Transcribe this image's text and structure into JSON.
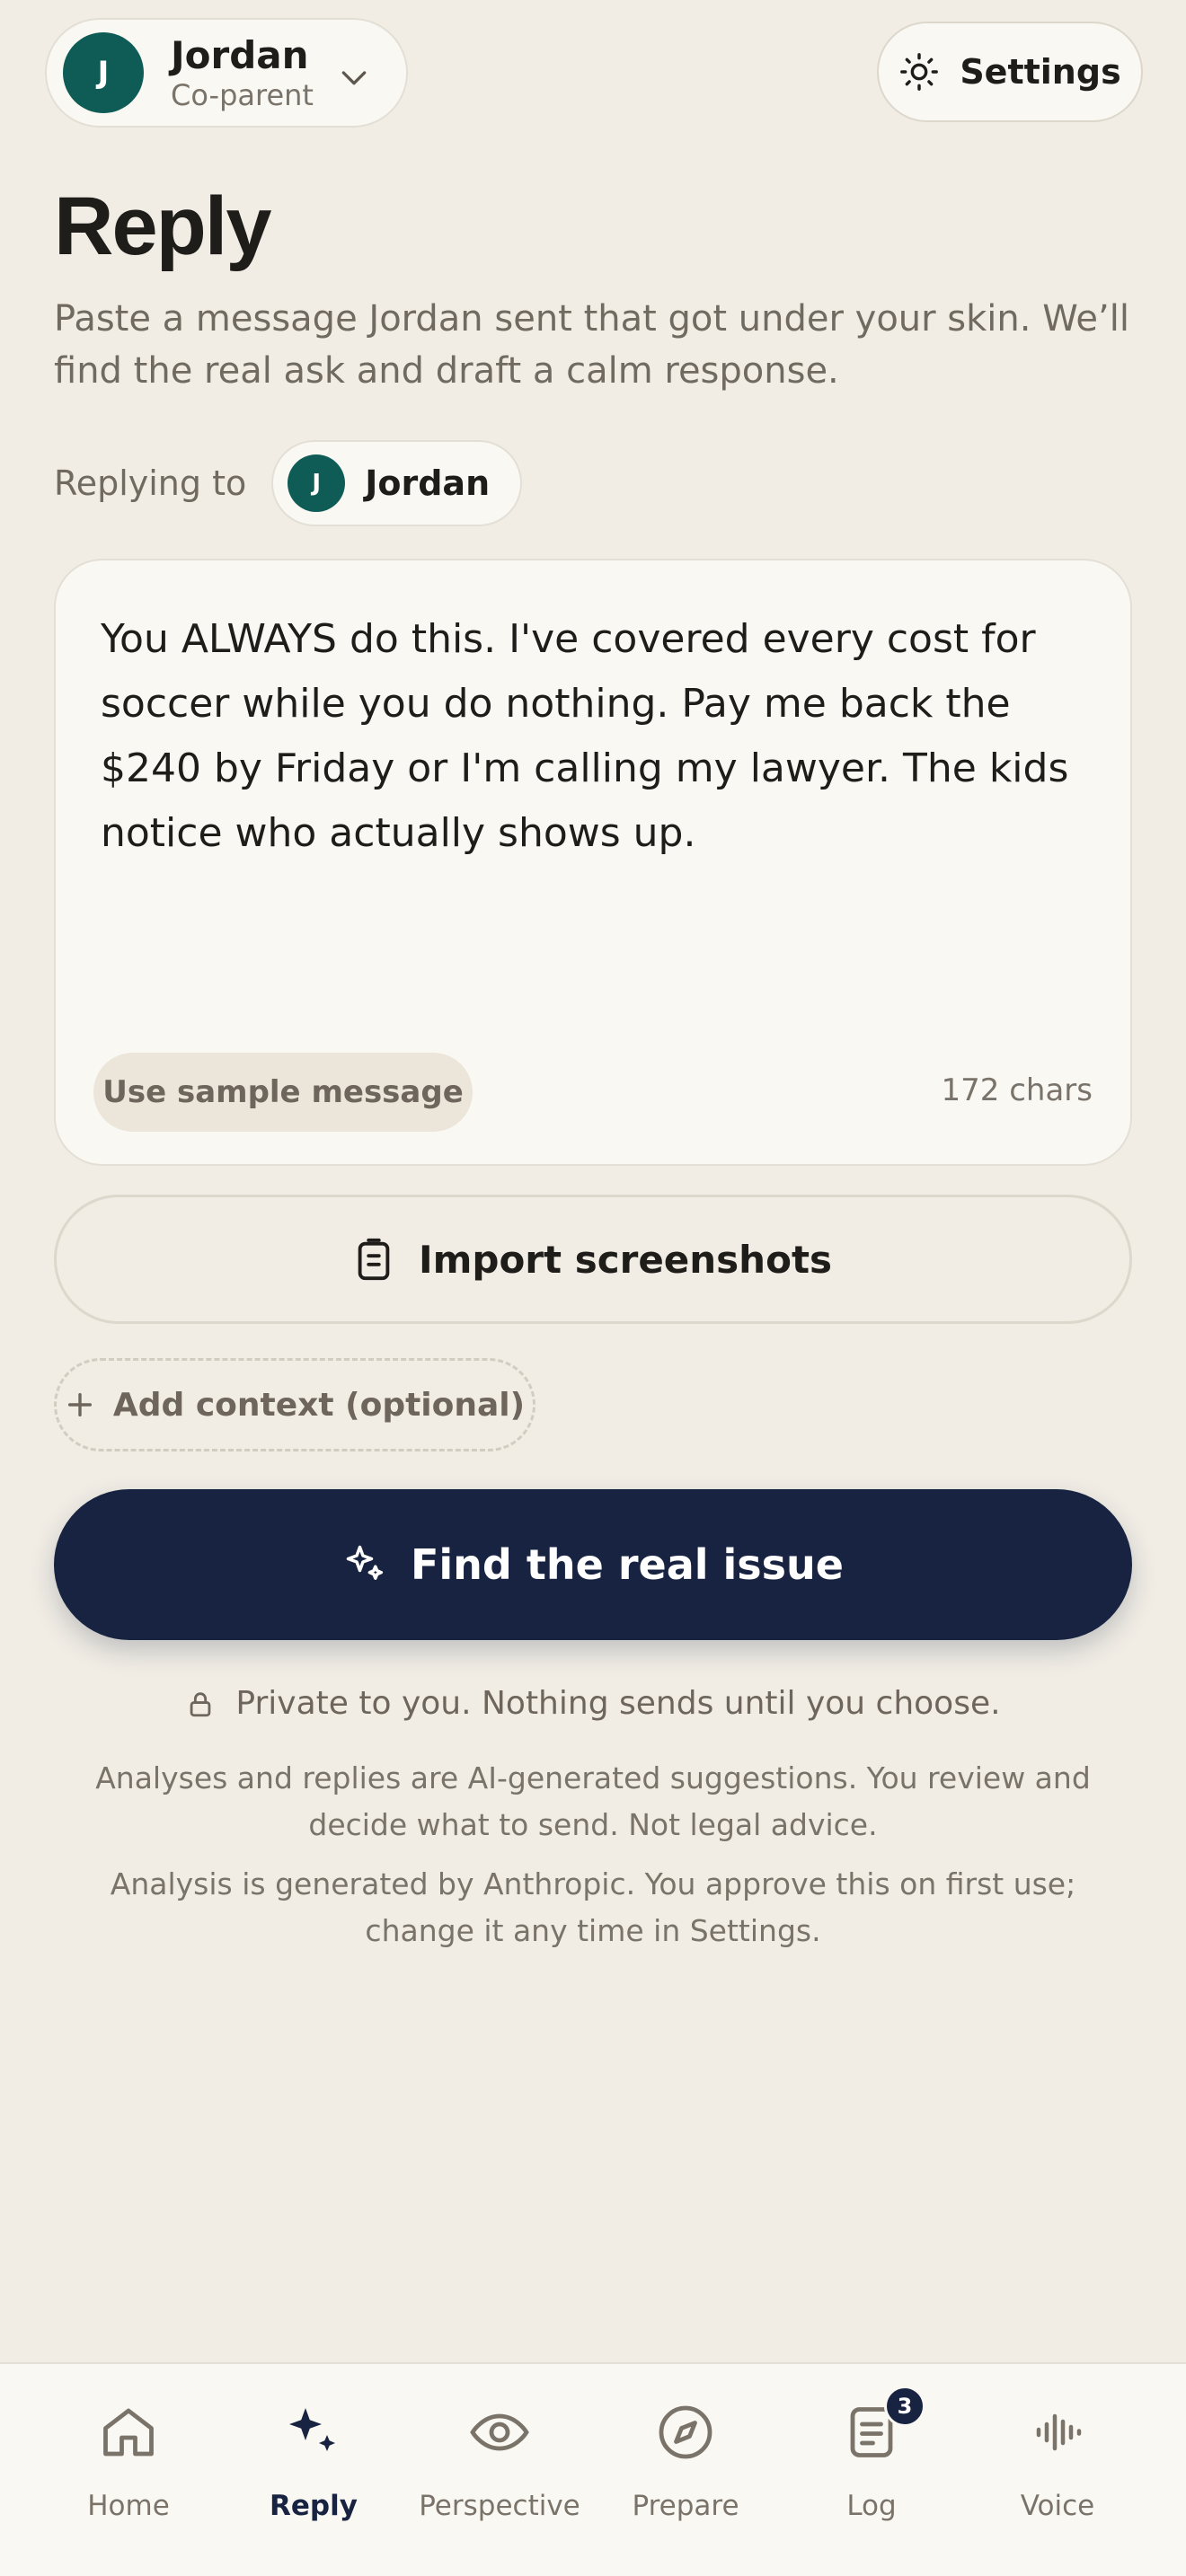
{
  "header": {
    "profile": {
      "initial": "J",
      "name": "Jordan",
      "role": "Co-parent"
    },
    "settings_label": "Settings"
  },
  "page": {
    "title": "Reply",
    "subtitle": "Paste a message Jordan sent that got under your skin. We’ll find the real ask and draft a calm response."
  },
  "recipient": {
    "label": "Replying to",
    "initial": "J",
    "name": "Jordan"
  },
  "message": {
    "text": "You ALWAYS do this. I've covered every cost for soccer while you do nothing. Pay me back the $240 by Friday or I'm calling my lawyer. The kids notice who actually shows up.",
    "sample_button": "Use sample message",
    "char_count": "172 chars"
  },
  "actions": {
    "import_label": "Import screenshots",
    "context_label": "Add context (optional)",
    "find_label": "Find the real issue"
  },
  "notes": {
    "private": "Private to you. Nothing sends until you choose.",
    "disclaimer_ai": "Analyses and replies are AI-generated suggestions. You review and decide what to send. Not legal advice.",
    "disclaimer_anthropic": "Analysis is generated by Anthropic. You approve this on first use; change it any time in Settings."
  },
  "nav": {
    "items": [
      {
        "label": "Home",
        "icon": "home-icon",
        "active": false
      },
      {
        "label": "Reply",
        "icon": "sparkle-icon",
        "active": true
      },
      {
        "label": "Perspective",
        "icon": "eye-icon",
        "active": false
      },
      {
        "label": "Prepare",
        "icon": "compass-icon",
        "active": false
      },
      {
        "label": "Log",
        "icon": "document-icon",
        "active": false,
        "badge": "3"
      },
      {
        "label": "Voice",
        "icon": "waveform-icon",
        "active": false
      }
    ]
  },
  "colors": {
    "background": "#f1ede5",
    "card": "#faf8f3",
    "primary": "#172340",
    "avatar": "#0f5c56",
    "muted_text": "#716a61"
  }
}
